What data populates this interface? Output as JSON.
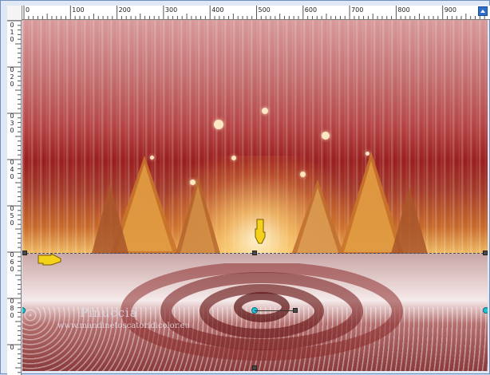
{
  "ruler_top": {
    "labels": [
      "0",
      "100",
      "200",
      "300",
      "400",
      "500",
      "600",
      "700",
      "800",
      "900"
    ]
  },
  "ruler_left": {
    "labels": [
      "0",
      "1",
      "0",
      "0",
      "2",
      "0",
      "0",
      "3",
      "0",
      "0",
      "4",
      "0",
      "0",
      "5",
      "0",
      "0",
      "6",
      "0",
      "0",
      "8",
      "0",
      "0"
    ]
  },
  "watermark": {
    "title": "Pinuccia",
    "url": "www.mandinetoscatoridicolor.eu"
  },
  "icons": {
    "pointer_right": "pointing-hand-right-icon",
    "pointer_down": "pointing-hand-down-icon"
  },
  "colors": {
    "hand_yellow": "#f5d21a",
    "selection_handle_cyan": "#19c4d6",
    "titlebar_blue": "#2c6ec6"
  }
}
